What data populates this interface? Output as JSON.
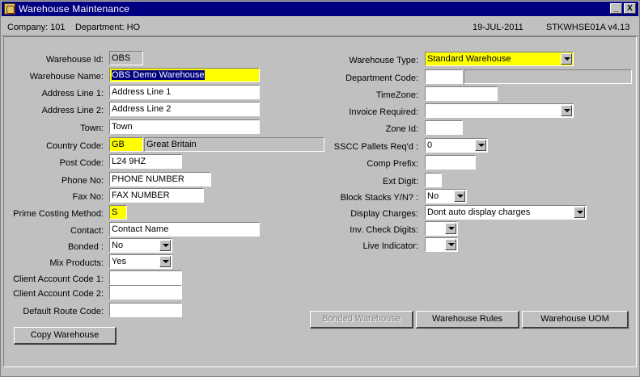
{
  "window": {
    "title": "Warehouse Maintenance",
    "minimize": "_",
    "close": "X"
  },
  "infobar": {
    "company": "Company:  101",
    "department": "Department:  HO",
    "date": "19-JUL-2011",
    "program": "STKWHSE01A  v4.13"
  },
  "left": {
    "warehouse_id": {
      "label": "Warehouse Id:",
      "value": "OBS"
    },
    "warehouse_name": {
      "label": "Warehouse Name:",
      "value": "OBS Demo Warehouse"
    },
    "address1": {
      "label": "Address Line 1:",
      "value": "Address Line 1"
    },
    "address2": {
      "label": "Address Line 2:",
      "value": "Address Line 2"
    },
    "town": {
      "label": "Town:",
      "value": "Town"
    },
    "country": {
      "label": "Country Code:",
      "code": "GB",
      "name": "Great Britain"
    },
    "postcode": {
      "label": "Post Code:",
      "value": "L24 9HZ"
    },
    "phone": {
      "label": "Phone No:",
      "value": "PHONE NUMBER"
    },
    "fax": {
      "label": "Fax No:",
      "value": "FAX NUMBER"
    },
    "prime_costing": {
      "label": "Prime Costing Method:",
      "value": "S"
    },
    "contact": {
      "label": "Contact:",
      "value": "Contact Name"
    },
    "bonded": {
      "label": "Bonded :",
      "value": "No"
    },
    "mix_products": {
      "label": "Mix Products:",
      "value": "Yes"
    },
    "client_acc1": {
      "label": "Client Account Code 1:",
      "value": ""
    },
    "client_acc2": {
      "label": "Client Account Code 2:",
      "value": ""
    },
    "default_route": {
      "label": "Default Route Code:",
      "value": ""
    }
  },
  "right": {
    "warehouse_type": {
      "label": "Warehouse Type:",
      "value": "Standard Warehouse"
    },
    "department_code": {
      "label": "Department Code:",
      "value": ""
    },
    "timezone": {
      "label": "TimeZone:",
      "value": ""
    },
    "invoice_required": {
      "label": "Invoice Required:",
      "value": ""
    },
    "zone_id": {
      "label": "Zone Id:",
      "value": ""
    },
    "sscc_pallets": {
      "label": "SSCC Pallets Req'd :",
      "value": "0"
    },
    "comp_prefix": {
      "label": "Comp Prefix:",
      "value": ""
    },
    "ext_digit": {
      "label": "Ext Digit:",
      "value": ""
    },
    "block_stacks": {
      "label": "Block Stacks Y/N? :",
      "value": "No"
    },
    "display_charges": {
      "label": "Display Charges:",
      "value": "Dont auto display charges"
    },
    "inv_check_digits": {
      "label": "Inv. Check Digits:",
      "value": ""
    },
    "live_indicator": {
      "label": "Live Indicator:",
      "value": ""
    }
  },
  "buttons": {
    "copy_warehouse": "Copy Warehouse",
    "bonded_warehouse": "Bonded Warehouse",
    "warehouse_rules": "Warehouse Rules",
    "warehouse_uom": "Warehouse UOM"
  }
}
